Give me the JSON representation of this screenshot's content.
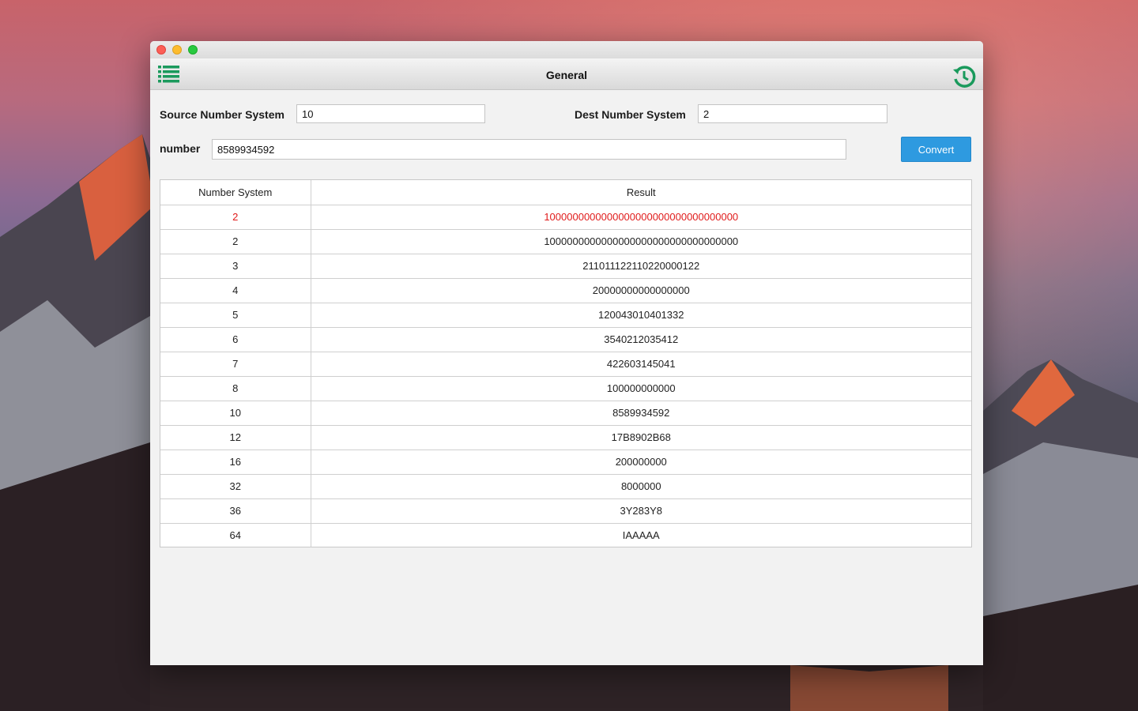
{
  "toolbar": {
    "title": "General"
  },
  "form": {
    "source_label": "Source Number System",
    "source_value": "10",
    "dest_label": "Dest Number System",
    "dest_value": "2",
    "number_label": "number",
    "number_value": "8589934592",
    "convert_label": "Convert"
  },
  "table": {
    "headers": [
      "Number System",
      "Result"
    ],
    "rows": [
      {
        "system": "2",
        "result": "1000000000000000000000000000000000"
      },
      {
        "system": "2",
        "result": "1000000000000000000000000000000000"
      },
      {
        "system": "3",
        "result": "211011122110220000122"
      },
      {
        "system": "4",
        "result": "20000000000000000"
      },
      {
        "system": "5",
        "result": "120043010401332"
      },
      {
        "system": "6",
        "result": "3540212035412"
      },
      {
        "system": "7",
        "result": "422603145041"
      },
      {
        "system": "8",
        "result": "100000000000"
      },
      {
        "system": "10",
        "result": "8589934592"
      },
      {
        "system": "12",
        "result": "17B8902B68"
      },
      {
        "system": "16",
        "result": "200000000"
      },
      {
        "system": "32",
        "result": "8000000"
      },
      {
        "system": "36",
        "result": "3Y283Y8"
      },
      {
        "system": "64",
        "result": "IAAAAA"
      }
    ]
  },
  "colors": {
    "accent": "#2e9ae0",
    "icon_green": "#1a9a5c",
    "highlight_red": "#e01b1b"
  },
  "icons": {
    "menu": "list-icon",
    "history": "history-icon"
  }
}
